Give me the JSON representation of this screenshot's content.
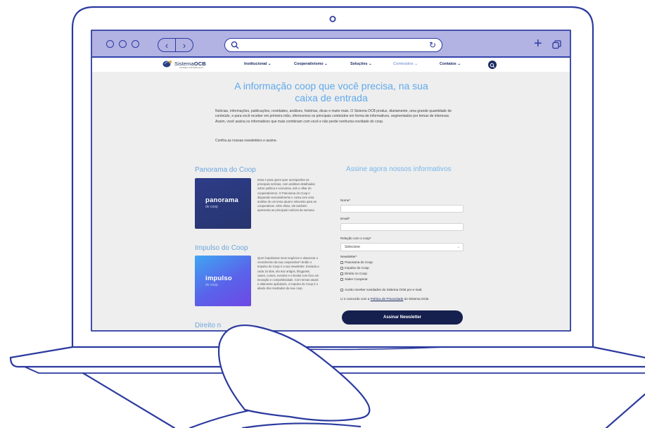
{
  "browser": {
    "back_label": "‹",
    "forward_label": "›",
    "address_value": "",
    "reload_label": "↻",
    "new_tab_label": "+"
  },
  "site": {
    "logo": {
      "prefix": "Sistema",
      "brand": "OCB",
      "tagline": "SISTEMA OCB SERVIÇOS"
    },
    "nav": [
      {
        "label": "Institucional ⌄"
      },
      {
        "label": "Cooperativismo ⌄"
      },
      {
        "label": "Soluções ⌄"
      },
      {
        "label": "Conteúdos ⌄",
        "active": true
      },
      {
        "label": "Contatos ⌄"
      }
    ]
  },
  "hero": {
    "title_line1": "A informação coop que você precisa, na sua",
    "title_line2": "caixa de entrada",
    "intro": "Notícias, informações, publicações, novidades, análises, histórias, dicas e muito mais. O Sistema OCB produz, diariamente, uma grande quantidade de conteúdo, e para você receber em primeira mão, oferecemos os principais conteúdos em forma de informativos, segmentados por temas de interesse. Assim, você assina os informativos que mais combinam com você e não perde nenhuma novidade do coop.",
    "cta": "Confira as nossas newsletters e assine."
  },
  "newsletters": [
    {
      "title": "Panorama do Coop",
      "tile_big": "panorama",
      "tile_small": "do coop",
      "description": "Essa é para quem quer acompanhar as principais notícias, com análises detalhadas sobre política e economia, sob o olhar do cooperativismo. O Panorama do Coop é disparado semanalmente e conta com uma análise de um tema atual e relevante para as cooperativas. Além disso, ele também apresenta as principais notícias da semana."
    },
    {
      "title": "Impulso do Coop",
      "tile_big": "impulso",
      "tile_small": "do coop",
      "description": "Quer impulsionar seus negócios e alavancar o crescimento da sua cooperativa? Então o Impulso do Coop é a sua newsletter. Enviada a cada 15 dias, ela traz artigos, blogposts, cases, cursos, eventos e e-books com foco em inovação e competitividade. Com temas atuais e altamente aplicáveis, o Impulso do Coop é o aliado dos resultados da sua coop."
    },
    {
      "title": "Direito n",
      "tile_big": "",
      "tile_small": "",
      "description": ""
    }
  ],
  "form": {
    "title": "Assine agora nossos informativos",
    "name_label": "Nome*",
    "email_label": "Email*",
    "relation_label": "Relação com o coop*",
    "relation_selected": "Selecione",
    "newsletter_label": "Newsletter*",
    "options": [
      "Panorama do Coop",
      "Impulso do Coop",
      "Direito no Coop",
      "Saber Cooperar"
    ],
    "consent": "Aceito receber novidades do Sistema OCB por e-mail.",
    "privacy_prefix": "Li e concordo com a ",
    "privacy_link": "Política de Privacidade",
    "privacy_suffix": " do Sistema OCB.",
    "submit_label": "Assinar Newsletter"
  }
}
